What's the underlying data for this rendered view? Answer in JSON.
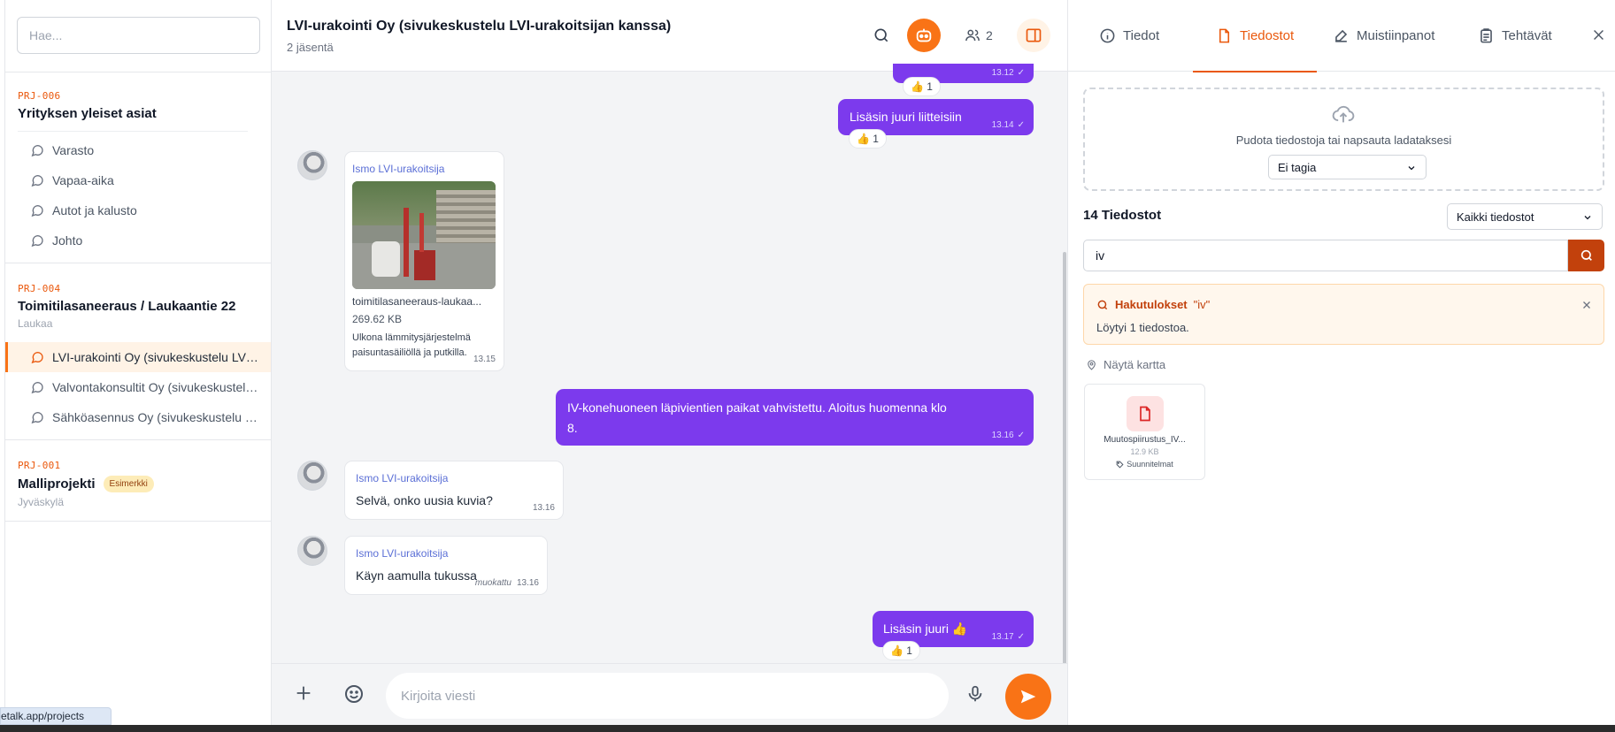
{
  "sidebar": {
    "search_placeholder": "Hae...",
    "projects": [
      {
        "code": "PRJ-006",
        "title": "Yrityksen yleiset asiat",
        "channels": [
          "Varasto",
          "Vapaa-aika",
          "Autot ja kalusto",
          "Johto"
        ]
      },
      {
        "code": "PRJ-004",
        "title": "Toimitilasaneeraus / Laukaantie 22",
        "subtitle": "Laukaa",
        "channels": [
          "LVI-urakointi Oy (sivukeskustelu LVI-urakoitsijan kanssa)",
          "Valvontakonsultit Oy (sivukeskustelu valvojan kanssa)",
          "Sähköasennus Oy (sivukeskustelu sähköurakoitsijan kanssa)"
        ],
        "active_channel": 0
      },
      {
        "code": "PRJ-001",
        "title": "Malliprojekti",
        "badge": "Esimerkki",
        "subtitle": "Jyväskylä"
      }
    ]
  },
  "chat": {
    "title": "LVI-urakointi Oy (sivukeskustelu LVI-urakoitsijan kanssa)",
    "subtitle": "2 jäsentä",
    "members_count": "2",
    "messages": {
      "m0_time": "13.12",
      "m0_reaction": "👍 1",
      "m1_text": "Lisäsin juuri liitteisiin",
      "m1_time": "13.14",
      "m1_reaction": "👍 1",
      "m2_sender": "Ismo LVI-urakoitsija",
      "m2_filename": "toimitilasaneeraus-laukaa...",
      "m2_filesize": "269.62 KB",
      "m2_caption": "Ulkona lämmitysjärjestelmä paisuntasäiliöllä ja putkilla.",
      "m2_time": "13.15",
      "m3_text": "IV-konehuoneen läpivientien paikat vahvistettu. Aloitus huomenna klo 8.",
      "m3_time": "13.16",
      "m4_sender": "Ismo LVI-urakoitsija",
      "m4_text": "Selvä, onko uusia kuvia?",
      "m4_time": "13.16",
      "m5_sender": "Ismo LVI-urakoitsija",
      "m5_text": "Käyn aamulla tukussa",
      "m5_edited": "muokattu",
      "m5_time": "13.16",
      "m6_text": "Lisäsin juuri 👍",
      "m6_time": "13.17",
      "m6_reaction": "👍 1"
    },
    "composer_placeholder": "Kirjoita viesti"
  },
  "right_panel": {
    "tabs": [
      "Tiedot",
      "Tiedostot",
      "Muistiinpanot",
      "Tehtävät"
    ],
    "active_tab": "Tiedostot",
    "upload_text": "Pudota tiedostoja tai napsauta ladataksesi",
    "tag_select": "Ei tagia",
    "files_count_title": "14 Tiedostot",
    "files_filter": "Kaikki tiedostot",
    "search_value": "iv",
    "results_title": "Hakutulokset",
    "results_query": "\"iv\"",
    "results_text": "Löytyi 1 tiedostoa.",
    "map_link": "Näytä kartta",
    "file": {
      "name": "Muutospiirustus_IV...",
      "size": "12.9 KB",
      "tag": "Suunnitelmat"
    }
  },
  "status_url": "etalk.app/projects",
  "colors": {
    "accent": "#f97316",
    "message_out": "#7c3aed",
    "sender": "#5b6fd6"
  }
}
